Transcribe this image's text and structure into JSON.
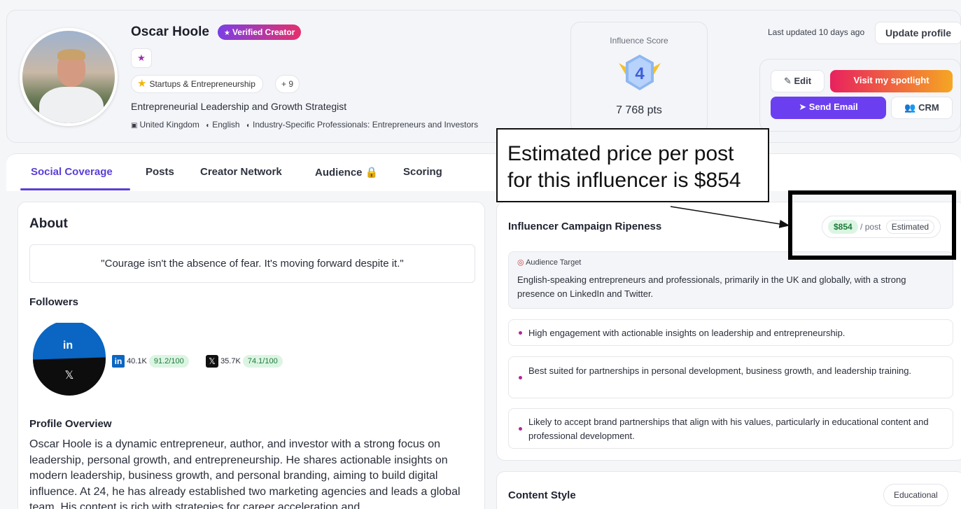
{
  "profile": {
    "name": "Oscar Hoole",
    "verified_label": "Verified Creator",
    "category": "Startups & Entrepreneurship",
    "more_categories": "+ 9",
    "tagline": "Entrepreneurial Leadership and Growth Strategist",
    "country": "United Kingdom",
    "language": "English",
    "audience_segment": "Industry-Specific Professionals: Entrepreneurs and Investors"
  },
  "influence": {
    "title": "Influence Score",
    "score": "4",
    "points": "7 768 pts"
  },
  "header_actions": {
    "last_updated": "Last updated 10 days ago",
    "update_label": "Update profile",
    "edit_label": "Edit",
    "spotlight_label": "Visit my spotlight",
    "email_label": "Send Email",
    "crm_label": "CRM"
  },
  "tabs": [
    {
      "label": "Social Coverage",
      "active": true
    },
    {
      "label": "Posts"
    },
    {
      "label": "Creator Network"
    },
    {
      "label": "Audience"
    },
    {
      "label": "Scoring"
    }
  ],
  "about": {
    "title": "About",
    "quote": "\"Courage isn't the absence of fear. It's moving forward despite it.\"",
    "followers_title": "Followers",
    "linkedin": {
      "followers": "40.1K",
      "score": "91.2/100",
      "share": 0.53
    },
    "x": {
      "followers": "35.7K",
      "score": "74.1/100",
      "share": 0.47
    },
    "overview_title": "Profile Overview",
    "overview_text": "Oscar Hoole is a dynamic entrepreneur, author, and investor with a strong focus on leadership, personal growth, and entrepreneurship. He shares actionable insights on modern leadership, business growth, and personal branding, aiming to build digital influence. At 24, he has already established two marketing agencies and leads a global team. His content is rich with strategies for career acceleration and"
  },
  "ripeness": {
    "title": "Influencer Campaign Ripeness",
    "price": "$854",
    "price_unit": "/ post",
    "price_note": "Estimated",
    "target_label": "Audience Target",
    "target_text": "English-speaking entrepreneurs and professionals, primarily in the UK and globally, with a strong presence on LinkedIn and Twitter.",
    "insights": [
      "High engagement with actionable insights on leadership and entrepreneurship.",
      "Best suited for partnerships in personal development, business growth, and leadership training.",
      "Likely to accept brand partnerships that align with his values, particularly in educational content and professional development."
    ]
  },
  "content_style": {
    "title": "Content Style",
    "tag": "Educational"
  },
  "annotation": {
    "line1": "Estimated price per post",
    "line2": "for this influencer is $854"
  },
  "colors": {
    "accent": "#5a3fd6",
    "email_button": "#6b3ff0",
    "linkedin": "#0a66c2",
    "score_pill_bg": "#dcf5e3"
  }
}
